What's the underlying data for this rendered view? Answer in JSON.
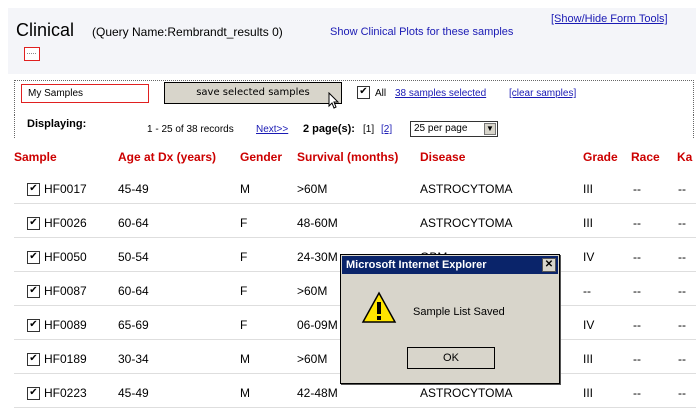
{
  "header": {
    "title": "Clinical",
    "subtitle": "(Query Name:Rembrandt_results 0)",
    "plots_link": "Show Clinical Plots for these samples",
    "toggle_tools_link": "[Show/Hide Form Tools]"
  },
  "toolbar": {
    "sample_list_value": "My Samples",
    "save_label": "save selected samples",
    "all_label": "All",
    "selected_link": "38 samples selected",
    "clear_link": "[clear samples]",
    "all_checked": true
  },
  "display": {
    "label": "Displaying:",
    "records_text": "1 - 25 of 38 records",
    "next_link": "Next>>",
    "pages_label": "2 page(s):",
    "current_page": "[1]",
    "page_2_link": "[2]",
    "per_page": "25 per page"
  },
  "table": {
    "columns": [
      "Sample",
      "Age at Dx (years)",
      "Gender",
      "Survival (months)",
      "Disease",
      "Grade",
      "Race",
      "Ka"
    ],
    "rows": [
      {
        "sample": "HF0017",
        "age": "45-49",
        "gender": "M",
        "survival": ">60M",
        "disease": "ASTROCYTOMA",
        "grade": "III",
        "race": "--",
        "ka": "--"
      },
      {
        "sample": "HF0026",
        "age": "60-64",
        "gender": "F",
        "survival": "48-60M",
        "disease": "ASTROCYTOMA",
        "grade": "III",
        "race": "--",
        "ka": "--"
      },
      {
        "sample": "HF0050",
        "age": "50-54",
        "gender": "F",
        "survival": "24-30M",
        "disease": "GBM",
        "grade": "IV",
        "race": "--",
        "ka": "--"
      },
      {
        "sample": "HF0087",
        "age": "60-64",
        "gender": "F",
        "survival": ">60M",
        "disease": "",
        "grade": "--",
        "race": "--",
        "ka": "--"
      },
      {
        "sample": "HF0089",
        "age": "65-69",
        "gender": "F",
        "survival": "06-09M",
        "disease": "",
        "grade": "IV",
        "race": "--",
        "ka": "--"
      },
      {
        "sample": "HF0189",
        "age": "30-34",
        "gender": "M",
        "survival": ">60M",
        "disease": "",
        "grade": "III",
        "race": "--",
        "ka": "--"
      },
      {
        "sample": "HF0223",
        "age": "45-49",
        "gender": "M",
        "survival": "42-48M",
        "disease": "ASTROCYTOMA",
        "grade": "III",
        "race": "--",
        "ka": "--"
      }
    ]
  },
  "dialog": {
    "title": "Microsoft Internet Explorer",
    "message": "Sample List Saved",
    "ok_label": "OK",
    "close_glyph": "✕"
  },
  "colors": {
    "header_red": "#cc0000",
    "link_blue": "#1a1ab4",
    "dialog_title_bg": "#0a246a",
    "button_face": "#d8d5cb"
  }
}
